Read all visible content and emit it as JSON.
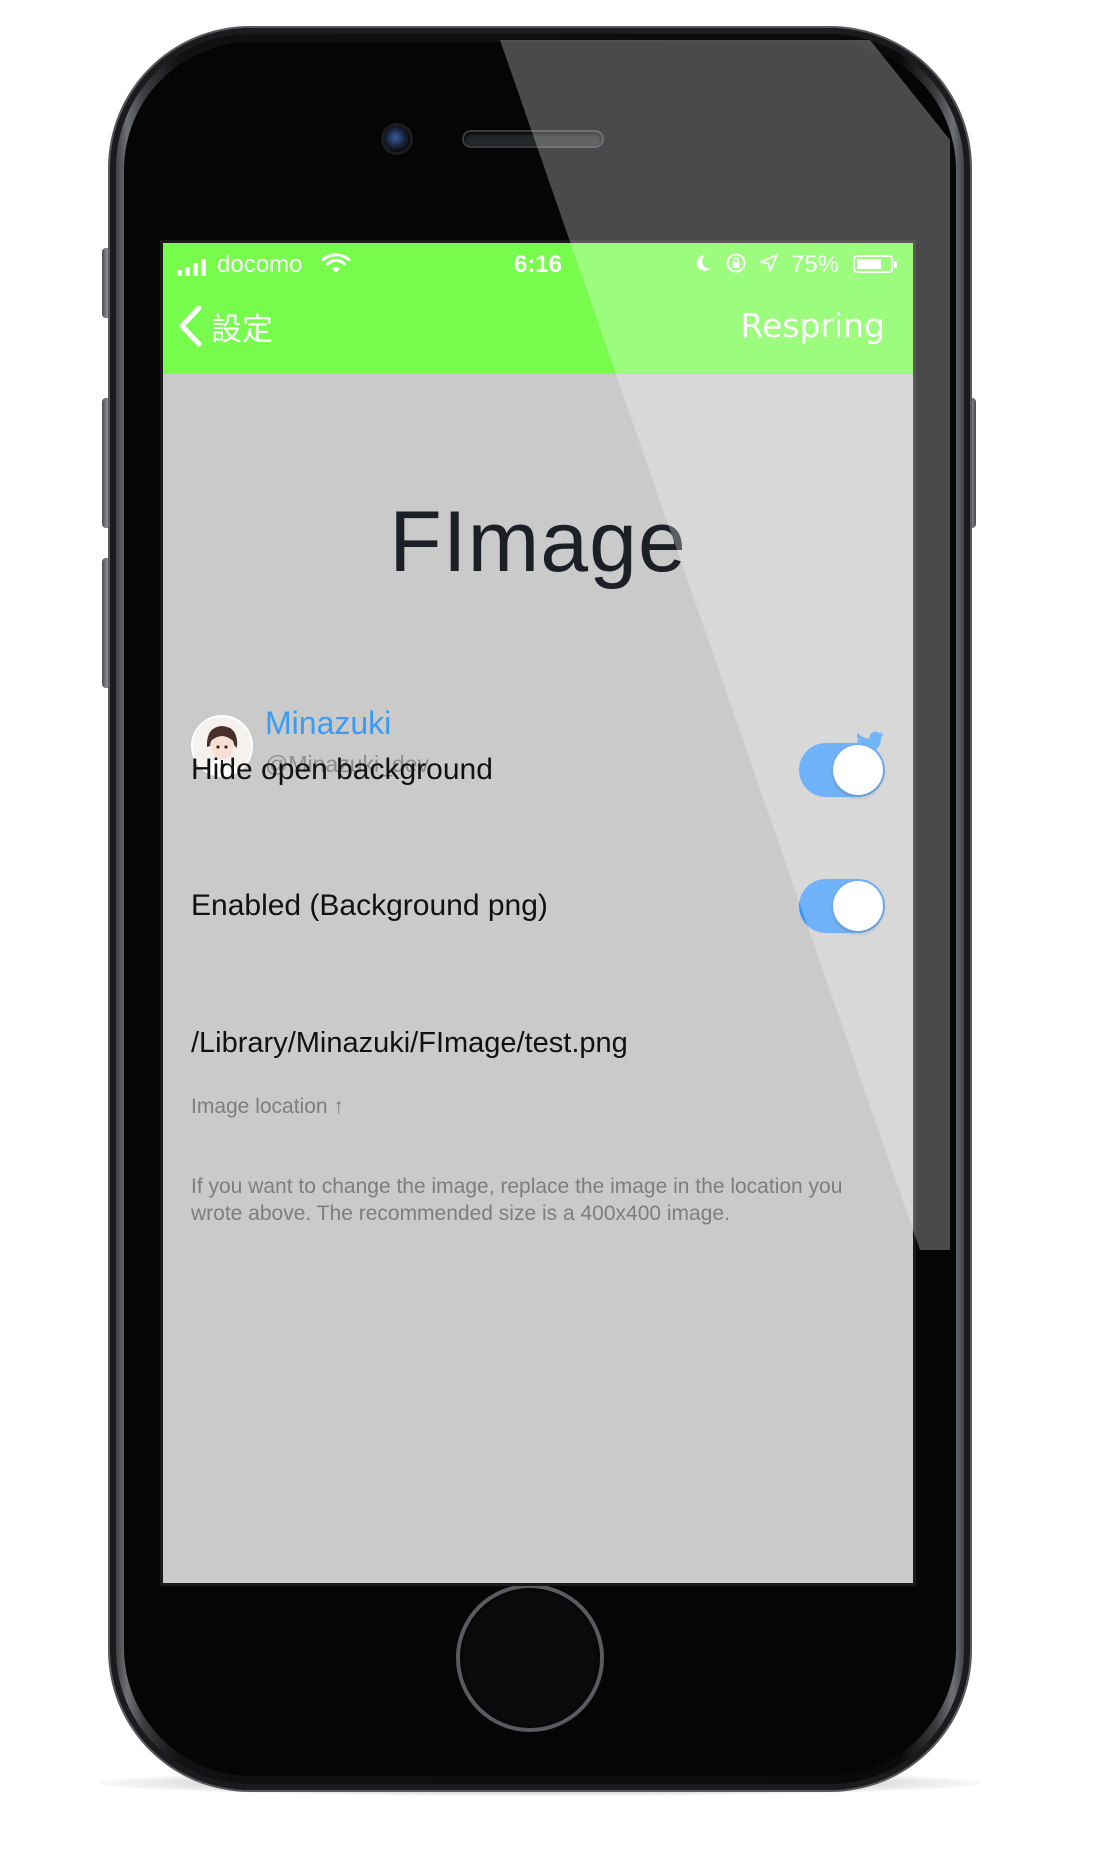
{
  "status_bar": {
    "carrier": "docomo",
    "time": "6:16",
    "battery_percent_text": "75%",
    "battery_level": 0.75,
    "signal_bars": 4
  },
  "nav": {
    "back_label": "設定",
    "respring_label": "Respring",
    "bar_color": "#77fb4c"
  },
  "app": {
    "title": "FImage"
  },
  "author": {
    "name": "Minazuki",
    "handle": "@Minazuki_dev",
    "link_icon": "twitter-icon",
    "accent_color": "#3b9bf5"
  },
  "settings": [
    {
      "label": "Hide open background",
      "enabled": true
    },
    {
      "label": "Enabled (Background png)",
      "enabled": true
    }
  ],
  "image_path": {
    "value": "/Library/Minazuki/FImage/test.png",
    "caption": "Image location ↑"
  },
  "info": {
    "text": "If you want to change the image, replace the image in the location you wrote above.  The recommended size is a 400x400 image."
  },
  "colors": {
    "toggle_on": "#3a95f7",
    "screen_bg": "#cacaca"
  }
}
